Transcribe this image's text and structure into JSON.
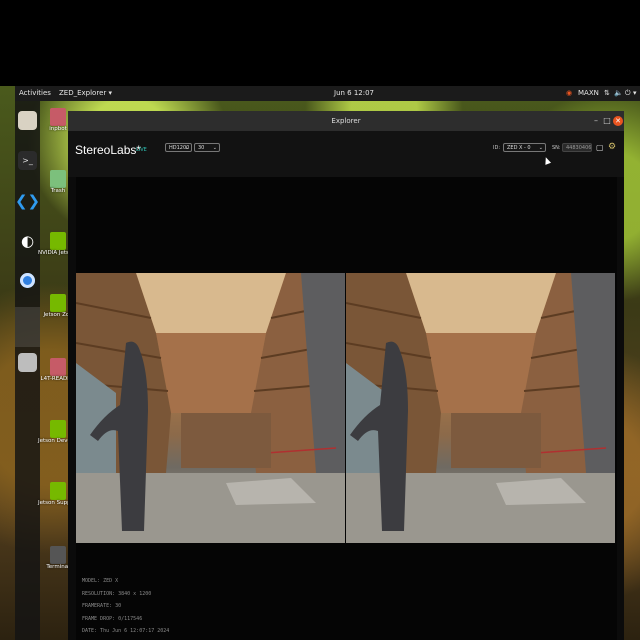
{
  "topbar": {
    "activities": "Activities",
    "app_menu": "ZED_Explorer ▾",
    "clock": "Jun 6 12:07",
    "power_mode": "MAXN"
  },
  "desktop": {
    "icons": [
      {
        "label": "inpbot"
      },
      {
        "label": "Trash"
      },
      {
        "label": "NVIDIA Jetson Community P"
      },
      {
        "label": "Jetson Zoo"
      },
      {
        "label": "L4T-README"
      },
      {
        "label": "Jetson Developer Z"
      },
      {
        "label": "Jetson Support Forums"
      },
      {
        "label": "Terminal"
      }
    ]
  },
  "window": {
    "title": "Explorer",
    "brand": "StereoLabs*",
    "live_label": "LIVE",
    "resolution_select": "HD1200",
    "fps_select": "30",
    "id_label": "ID:",
    "id_select": "ZED X - 0",
    "sn_label": "SN:",
    "sn_value": "44830406"
  },
  "info": {
    "model": "MODEL: ZED X",
    "resolution": "RESOLUTION: 3840 x 1200",
    "framerate": "FRAMERATE: 30",
    "frame_drop": "FRAME DROP: 0/117546",
    "date": "DATE: Thu Jun 6 12:07:17 2024"
  },
  "colors": {
    "accent_live": "#2ec4b6",
    "close_button": "#e95420"
  }
}
